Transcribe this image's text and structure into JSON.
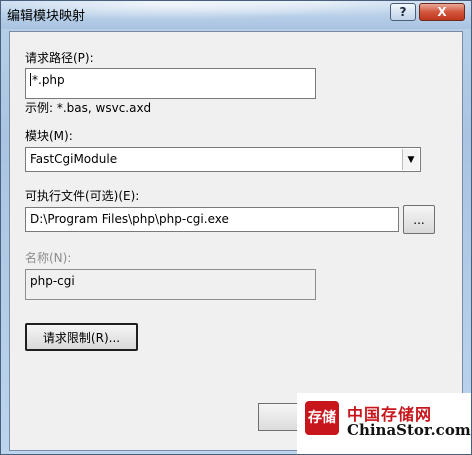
{
  "window": {
    "title": "编辑模块映射",
    "help_label": "?",
    "close_label": "X"
  },
  "form": {
    "request_path_label": "请求路径(P):",
    "request_path_value": "*.php",
    "example_text": "示例: *.bas, wsvc.axd",
    "module_label": "模块(M):",
    "module_value": "FastCgiModule",
    "executable_label": "可执行文件(可选)(E):",
    "executable_value": "D:\\Program Files\\php\\php-cgi.exe",
    "browse_label": "...",
    "name_label": "名称(N):",
    "name_value": "php-cgi",
    "restrictions_label": "请求限制(R)..."
  },
  "watermark": {
    "seal_text": "存储",
    "cn_text": "中国存储网",
    "en_text": "ChinaStor.com"
  },
  "colors": {
    "frame": "#a9c4e2",
    "client": "#f0f0f0",
    "close": "#c0371c",
    "watermark_red": "#c8161d"
  }
}
